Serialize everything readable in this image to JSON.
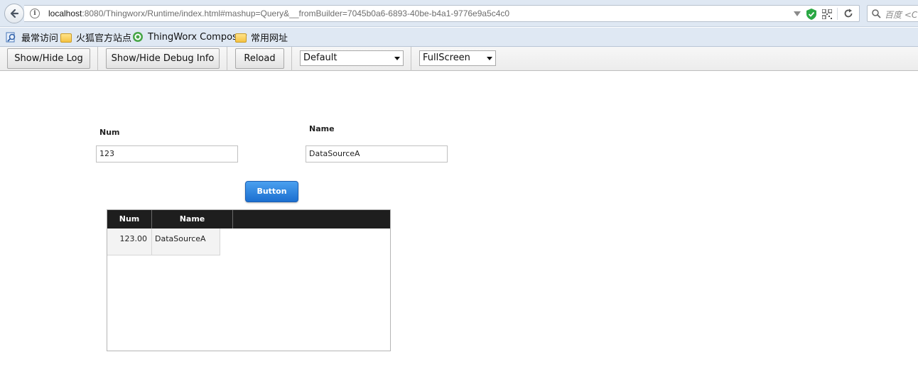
{
  "browser": {
    "url_host": "localhost",
    "url_rest": ":8080/Thingworx/Runtime/index.html#mashup=Query&__fromBuilder=7045b0a6-6893-40be-b4a1-9776e9a5c4c0",
    "search_placeholder": "百度 <Ct"
  },
  "bookmarks": [
    {
      "label": "最常访问",
      "icon": "bookmark-search-icon"
    },
    {
      "label": "火狐官方站点",
      "icon": "folder-icon"
    },
    {
      "label": "ThingWorx Composer",
      "icon": "thingworx-gear-icon"
    },
    {
      "label": "常用网址",
      "icon": "folder-icon"
    }
  ],
  "toolbar": {
    "show_hide_log": "Show/Hide Log",
    "show_hide_debug": "Show/Hide Debug Info",
    "reload": "Reload",
    "theme_select": "Default",
    "view_select": "FullScreen"
  },
  "mashup": {
    "num_label": "Num",
    "num_value": "123",
    "name_label": "Name",
    "name_value": "DataSourceA",
    "button_label": "Button",
    "grid": {
      "columns": [
        "Num",
        "Name"
      ],
      "rows": [
        {
          "num": "123.00",
          "name": "DataSourceA"
        }
      ]
    }
  },
  "colors": {
    "accent_button": "#1c6fd0",
    "grid_header": "#1e1e1e"
  }
}
